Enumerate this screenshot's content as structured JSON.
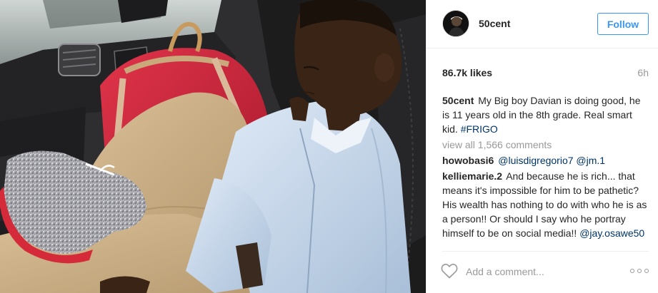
{
  "post": {
    "author": "50cent",
    "follow_label": "Follow",
    "likes": "86.7k likes",
    "time_ago": "6h",
    "caption": {
      "user": "50cent",
      "text": "My Big boy Davian is doing good, he is 11 years old in the 8th grade. Real smart kid.",
      "hashtag": "#FRIGO"
    },
    "view_all": "view all 1,566 comments",
    "comments": [
      {
        "user": "howobasi6",
        "mentions": [
          "@luisdigregorio7",
          "@jm.1"
        ]
      },
      {
        "user": "kelliemarie.2",
        "text": "And because he is rich... that means it's impossible for him to be pathetic? His wealth has nothing to do with who he is as a person!! Or should I say who he portray himself to be on social media!!",
        "mention": "@jay.osawe50"
      }
    ],
    "add_comment_placeholder": "Add a comment..."
  },
  "icons": {
    "like": "heart-outline-icon",
    "more": "more-options-icon"
  },
  "colors": {
    "accent_blue": "#3897f0",
    "link_blue": "#003569",
    "muted": "#999999",
    "text": "#262626"
  }
}
